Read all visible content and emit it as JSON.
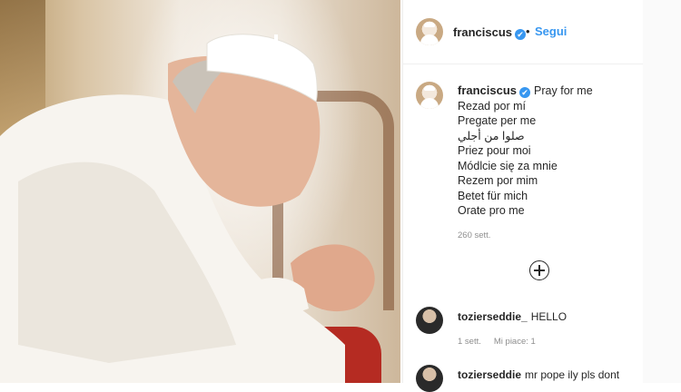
{
  "post": {
    "username": "franciscus",
    "verified_mark": "✔",
    "follow_separator": "•",
    "follow_label": "Segui",
    "caption_first": "Pray for me",
    "caption_lines": [
      "Rezad por mí",
      "Pregate per me",
      "صلوا من أجلي",
      "Priez pour moi",
      "Módlcie się za mnie",
      "Rezem por mim",
      "Betet für mich",
      "Orate pro me"
    ],
    "time_ago": "260 sett."
  },
  "comments": [
    {
      "username": "tozierseddie_",
      "text": "HELLO",
      "time": "1 sett.",
      "likes": "Mi piace: 1"
    },
    {
      "username": "tozierseddie",
      "text": "mr pope ily pls dont"
    }
  ],
  "icons": {
    "add_comment": "plus-circle-icon",
    "verified": "verified-badge-icon"
  },
  "colors": {
    "link_blue": "#3897f0",
    "muted": "#8e8e8e",
    "text": "#262626"
  }
}
